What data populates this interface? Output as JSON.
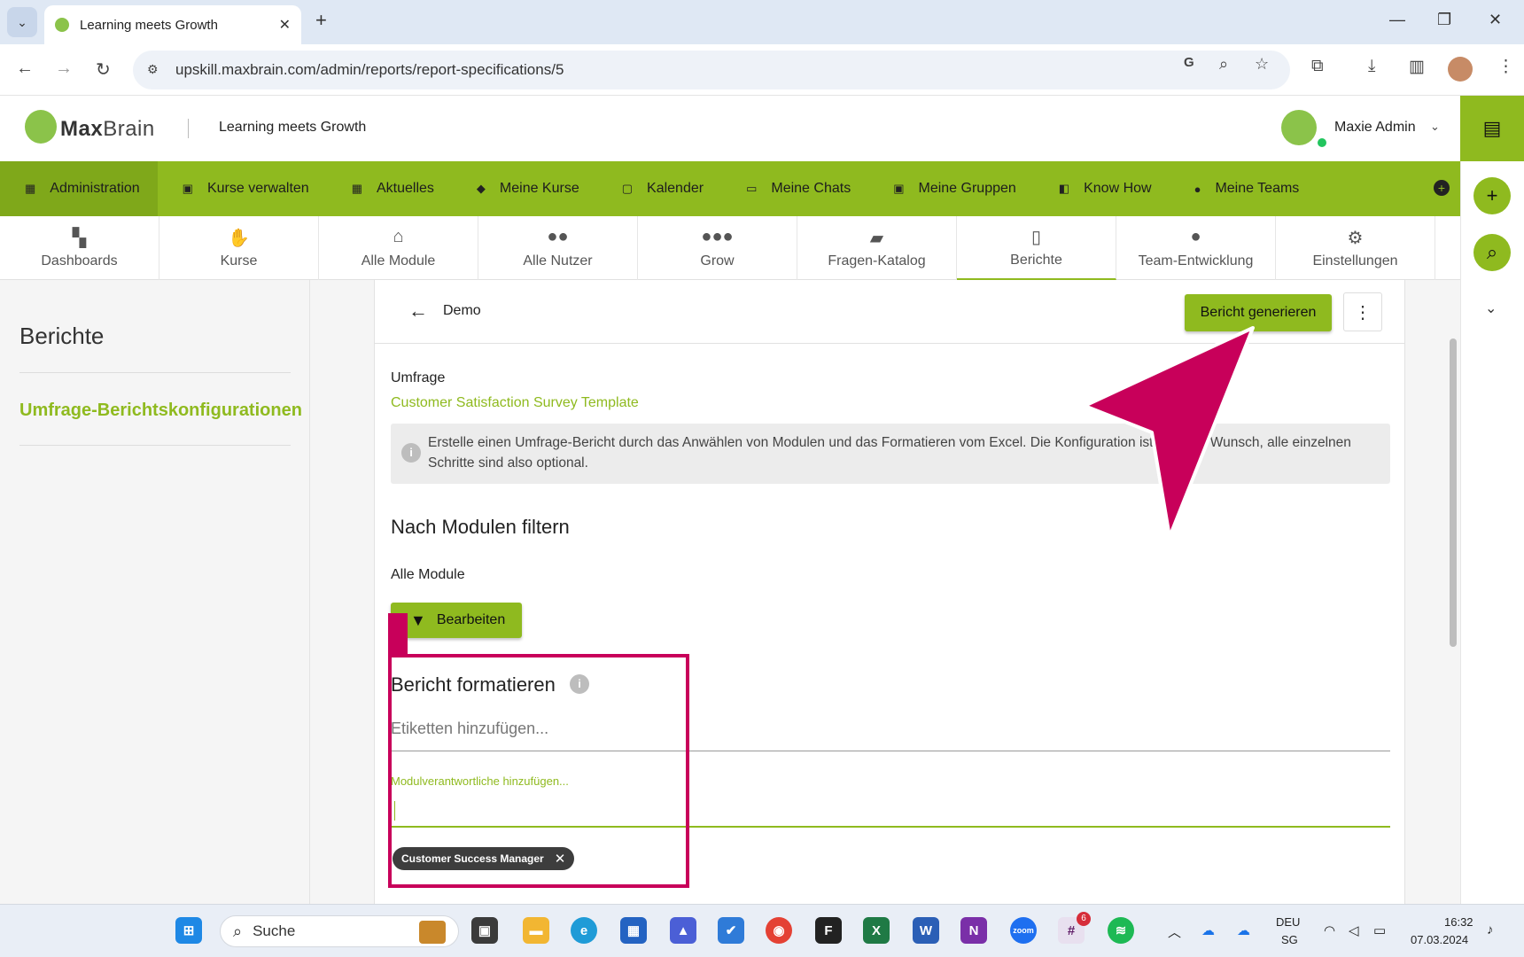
{
  "browser": {
    "tab_title": "Learning meets Growth",
    "url": "upskill.maxbrain.com/admin/reports/report-specifications/5",
    "new_tab": "+",
    "tab_close": "✕"
  },
  "header": {
    "logo_prefix": "Max",
    "logo_suffix": "Brain",
    "tagline": "Learning meets Growth",
    "user_name": "Maxie Admin"
  },
  "main_nav": [
    {
      "label": "Administration",
      "icon": "dashboard-icon"
    },
    {
      "label": "Kurse verwalten",
      "icon": "folder-person-icon"
    },
    {
      "label": "Aktuelles",
      "icon": "grid-icon"
    },
    {
      "label": "Meine Kurse",
      "icon": "graduation-cap-icon"
    },
    {
      "label": "Kalender",
      "icon": "calendar-icon"
    },
    {
      "label": "Meine Chats",
      "icon": "inbox-icon"
    },
    {
      "label": "Meine Gruppen",
      "icon": "folder-group-icon"
    },
    {
      "label": "Know How",
      "icon": "book-icon"
    },
    {
      "label": "Meine Teams",
      "icon": "team-icon"
    }
  ],
  "sub_nav": [
    {
      "label": "Dashboards",
      "icon": "dashboard-icon"
    },
    {
      "label": "Kurse",
      "icon": "hand-book-icon"
    },
    {
      "label": "Alle Module",
      "icon": "institution-icon"
    },
    {
      "label": "Alle Nutzer",
      "icon": "users-icon"
    },
    {
      "label": "Grow",
      "icon": "group-icon"
    },
    {
      "label": "Fragen-Katalog",
      "icon": "chat-bubbles-icon"
    },
    {
      "label": "Berichte",
      "icon": "report-icon"
    },
    {
      "label": "Team-Entwicklung",
      "icon": "team-development-icon"
    },
    {
      "label": "Einstellungen",
      "icon": "gears-icon"
    }
  ],
  "sidebar": {
    "title": "Berichte",
    "link": "Umfrage-Berichtskonfigurationen"
  },
  "content": {
    "title": "Demo",
    "generate_button": "Bericht generieren",
    "survey_label": "Umfrage",
    "survey_link": "Customer Satisfaction Survey Template",
    "info_line1": "Erstelle einen Umfrage-Bericht durch das Anwählen von Modulen und das Formatieren vom Excel. Die Konfiguration ist",
    "info_line1_end": "Wunsch, alle einzelnen",
    "info_line2": "Schritte sind also optional.",
    "filter_heading": "Nach Modulen filtern",
    "all_modules": "Alle Module",
    "edit_button": "Bearbeiten",
    "format_heading": "Bericht formatieren",
    "tags_placeholder": "Etiketten hinzufügen...",
    "owners_label": "Modulverantwortliche hinzufügen...",
    "chip_label": "Customer Success Manager"
  },
  "taskbar": {
    "search_label": "Suche",
    "lang_top": "DEU",
    "lang_bottom": "SG",
    "time": "16:32",
    "date": "07.03.2024",
    "slack_badge": "6"
  },
  "colors": {
    "brand_green": "#8fba1f",
    "annotation_magenta": "#c8005a"
  }
}
